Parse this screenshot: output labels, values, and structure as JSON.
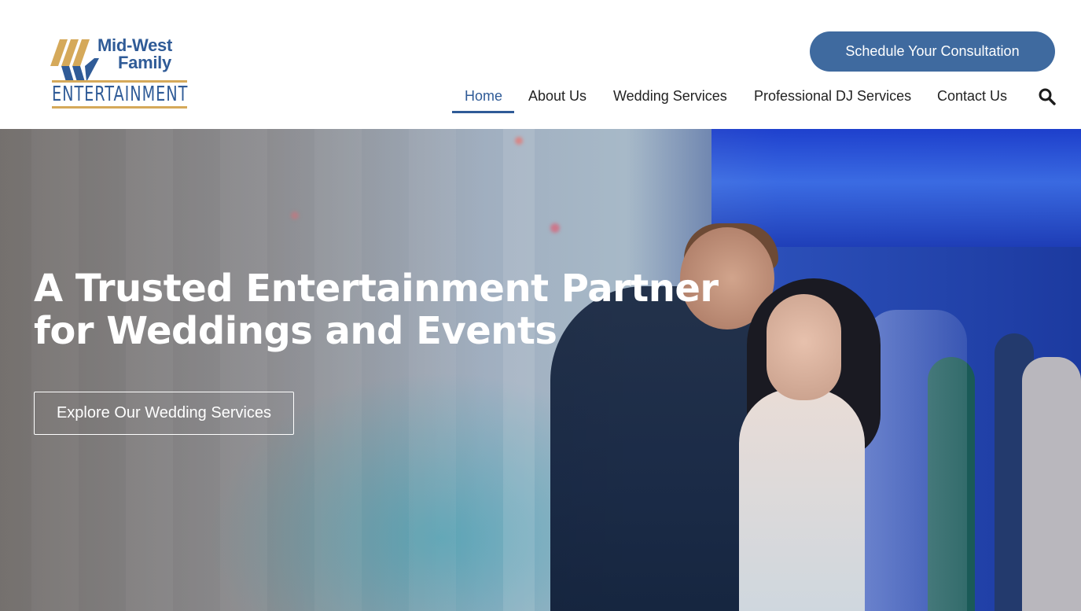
{
  "brand": {
    "line1": "Mid-West",
    "line2": "Family",
    "line3": "ENTERTAINMENT",
    "primary_color": "#2f5b97",
    "accent_color": "#d5a95a"
  },
  "header": {
    "cta_label": "Schedule Your Consultation",
    "cta_color": "#3f6a9f"
  },
  "nav": {
    "items": [
      {
        "label": "Home",
        "active": true
      },
      {
        "label": "About Us"
      },
      {
        "label": "Wedding Services"
      },
      {
        "label": "Professional DJ Services"
      },
      {
        "label": "Contact Us"
      }
    ],
    "search_icon": "search-icon"
  },
  "hero": {
    "title_line1": "A Trusted Entertainment Partner",
    "title_line2": "for Weddings and Events",
    "button_label": "Explore Our Wedding Services"
  }
}
